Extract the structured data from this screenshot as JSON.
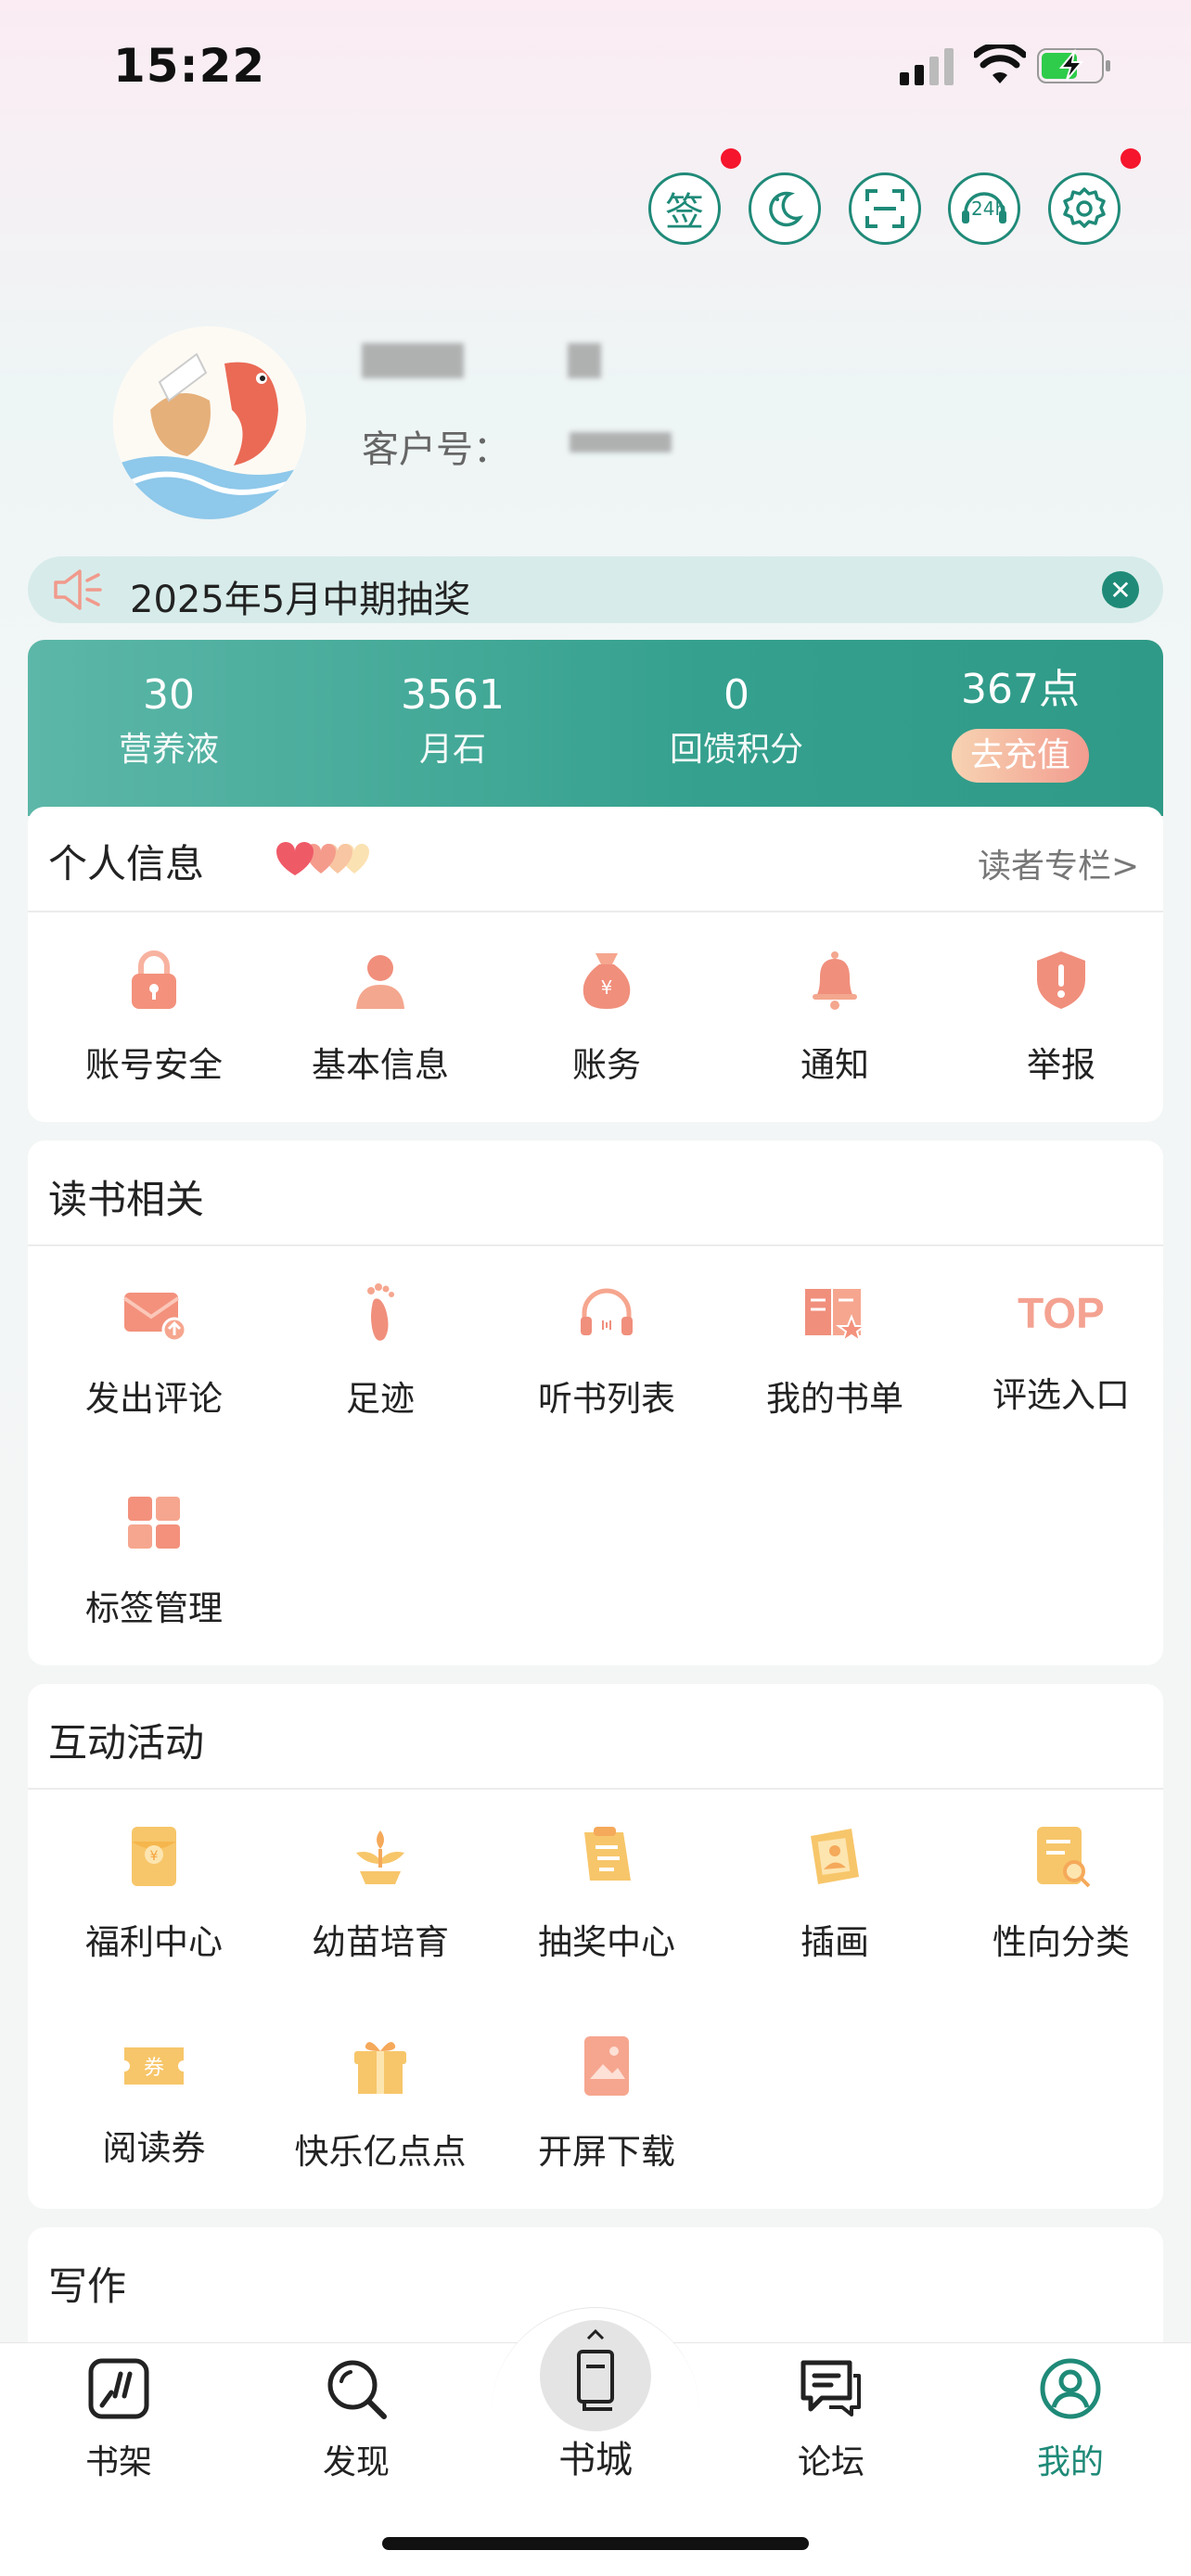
{
  "status_bar": {
    "time": "15:22"
  },
  "top_actions": [
    {
      "name": "sign-in-button",
      "label": "签"
    },
    {
      "name": "night-mode-button"
    },
    {
      "name": "scan-button"
    },
    {
      "name": "customer-service-24h-button",
      "label": "24h"
    },
    {
      "name": "settings-button"
    }
  ],
  "profile": {
    "customer_label": "客户号："
  },
  "notice": {
    "text": "2025年5月中期抽奖"
  },
  "stats": [
    {
      "value": "30",
      "label": "营养液"
    },
    {
      "value": "3561",
      "label": "月石"
    },
    {
      "value": "0",
      "label": "回馈积分"
    },
    {
      "value": "367点",
      "label": "去充值"
    }
  ],
  "personal": {
    "title": "个人信息",
    "link": "读者专栏>",
    "items": [
      {
        "label": "账号安全",
        "icon": "lock-icon"
      },
      {
        "label": "基本信息",
        "icon": "person-icon"
      },
      {
        "label": "账务",
        "icon": "money-bag-icon"
      },
      {
        "label": "通知",
        "icon": "bell-icon"
      },
      {
        "label": "举报",
        "icon": "shield-alert-icon"
      }
    ]
  },
  "reading": {
    "title": "读书相关",
    "items": [
      {
        "label": "发出评论",
        "icon": "comment-mail-icon"
      },
      {
        "label": "足迹",
        "icon": "footprint-icon"
      },
      {
        "label": "听书列表",
        "icon": "headphones-icon"
      },
      {
        "label": "我的书单",
        "icon": "booklist-icon"
      },
      {
        "label": "评选入口",
        "icon": "top-icon",
        "glyph": "TOP"
      },
      {
        "label": "标签管理",
        "icon": "tag-grid-icon"
      }
    ]
  },
  "activity": {
    "title": "互动活动",
    "items": [
      {
        "label": "福利中心",
        "icon": "red-envelope-icon"
      },
      {
        "label": "幼苗培育",
        "icon": "sprout-icon"
      },
      {
        "label": "抽奖中心",
        "icon": "lottery-note-icon"
      },
      {
        "label": "插画",
        "icon": "illustration-icon"
      },
      {
        "label": "性向分类",
        "icon": "category-search-icon"
      },
      {
        "label": "阅读券",
        "icon": "ticket-icon",
        "glyph": "券"
      },
      {
        "label": "快乐亿点点",
        "icon": "gift-icon"
      },
      {
        "label": "开屏下载",
        "icon": "splash-image-icon"
      }
    ]
  },
  "writing": {
    "title": "写作"
  },
  "nav": [
    {
      "label": "书架"
    },
    {
      "label": "发现"
    },
    {
      "label": "书城"
    },
    {
      "label": "论坛"
    },
    {
      "label": "我的"
    }
  ],
  "colors": {
    "accent": "#1f8a78",
    "icon_orange": "#f39b7a",
    "icon_yellow": "#f7c66a",
    "notify_red": "#f5152c"
  }
}
